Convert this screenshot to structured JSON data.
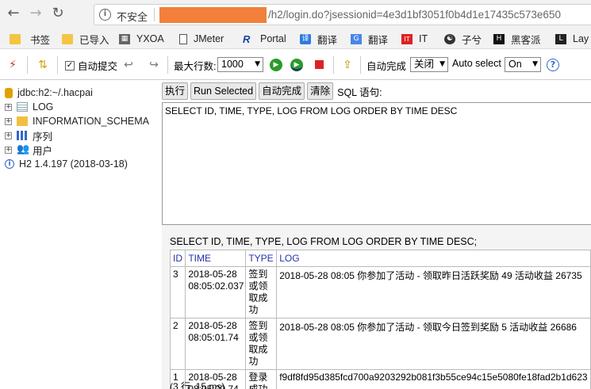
{
  "browser": {
    "back_icon": "arrow-left",
    "forward_icon": "arrow-right",
    "reload_icon": "reload",
    "security_label": "不安全",
    "url": "/h2/login.do?jsessionid=4e3d1bf3051f0b4d1e17435c573e650",
    "redaction_color": "#f27f3a"
  },
  "bookmarks": [
    {
      "label": "",
      "icon": "folder"
    },
    {
      "label": "书签",
      "icon": "folder"
    },
    {
      "label": "已导入",
      "icon": "folder"
    },
    {
      "label": "YXOA",
      "icon": "site"
    },
    {
      "label": "JMeter",
      "icon": "page"
    },
    {
      "label": "Portal",
      "icon": "R"
    },
    {
      "label": "翻译",
      "icon": "译"
    },
    {
      "label": "翻译",
      "icon": "G"
    },
    {
      "label": "IT",
      "icon": "IT"
    },
    {
      "label": "子兮",
      "icon": "leaf"
    },
    {
      "label": "黑客派",
      "icon": "H"
    },
    {
      "label": "Lay",
      "icon": "L"
    }
  ],
  "toolbar": {
    "autocommit_label": "自动提交",
    "autocommit_checked": "✓",
    "maxrows_label": "最大行数:",
    "maxrows_value": "1000",
    "autocomplete_label": "自动完成",
    "autocomplete_value": "关闭",
    "autoselect_label": "Auto select",
    "autoselect_value": "On",
    "help_icon": "?"
  },
  "tree": {
    "connection": "jdbc:h2:~/.hacpai",
    "items": [
      {
        "label": "LOG",
        "icon": "table-icon"
      },
      {
        "label": "INFORMATION_SCHEMA",
        "icon": "folder-icon"
      },
      {
        "label": "序列",
        "icon": "sequence-icon"
      },
      {
        "label": "用户",
        "icon": "users-icon"
      }
    ],
    "version": "H2 1.4.197 (2018-03-18)"
  },
  "query": {
    "run_label": "执行",
    "run_selected_label": "Run Selected",
    "autocomplete_label": "自动完成",
    "clear_label": "清除",
    "sql_label": "SQL 语句:",
    "sql_text": "SELECT ID, TIME, TYPE, LOG FROM LOG ORDER BY TIME DESC"
  },
  "results": {
    "statement": "SELECT ID, TIME, TYPE, LOG FROM LOG ORDER BY TIME DESC;",
    "columns": [
      "ID",
      "TIME",
      "TYPE",
      "LOG"
    ],
    "rows": [
      {
        "id": "3",
        "time": "2018-05-28 08:05:02.037",
        "type": "签到或领取成功",
        "log": "2018-05-28 08:05 你参加了活动 - 领取昨日活跃奖励 49 活动收益 26735"
      },
      {
        "id": "2",
        "time": "2018-05-28 08:05:01.74",
        "type": "签到或领取成功",
        "log": "2018-05-28 08:05 你参加了活动 - 领取今日签到奖励 5 活动收益 26686"
      },
      {
        "id": "1",
        "time": "2018-05-28 08:05:00.74",
        "type": "登录成功",
        "log": "f9df8fd95d385fcd700a9203292b081f3b55ce94c15e5080fe18fad2b1d623"
      }
    ],
    "count": "(3 行, 15 ms)"
  }
}
